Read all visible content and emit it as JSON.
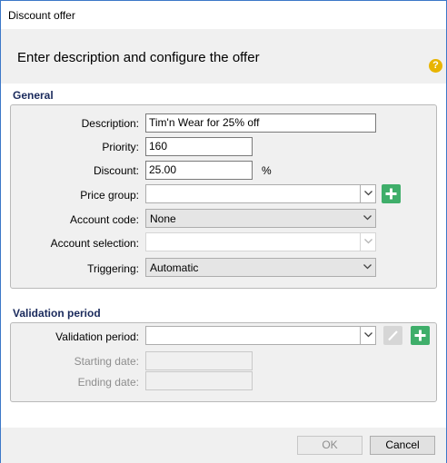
{
  "window": {
    "title": "Discount offer"
  },
  "header": {
    "heading": "Enter description and configure the offer",
    "help_icon": "help-icon",
    "help_glyph": "?"
  },
  "general": {
    "title": "General",
    "description": {
      "label": "Description:",
      "value": "Tim'n Wear for 25% off"
    },
    "priority": {
      "label": "Priority:",
      "value": "160"
    },
    "discount": {
      "label": "Discount:",
      "value": "25.00",
      "unit": "%"
    },
    "price_group": {
      "label": "Price group:",
      "value": ""
    },
    "account_code": {
      "label": "Account code:",
      "value": "None"
    },
    "account_selection": {
      "label": "Account selection:",
      "value": ""
    },
    "triggering": {
      "label": "Triggering:",
      "value": "Automatic"
    }
  },
  "validation": {
    "title": "Validation period",
    "period": {
      "label": "Validation period:",
      "value": ""
    },
    "starting_date": {
      "label": "Starting date:",
      "value": ""
    },
    "ending_date": {
      "label": "Ending date:",
      "value": ""
    }
  },
  "footer": {
    "ok_label": "OK",
    "cancel_label": "Cancel"
  },
  "colors": {
    "accent_green": "#3fae6a",
    "section_title": "#1a2a5c",
    "help": "#e8b400"
  }
}
